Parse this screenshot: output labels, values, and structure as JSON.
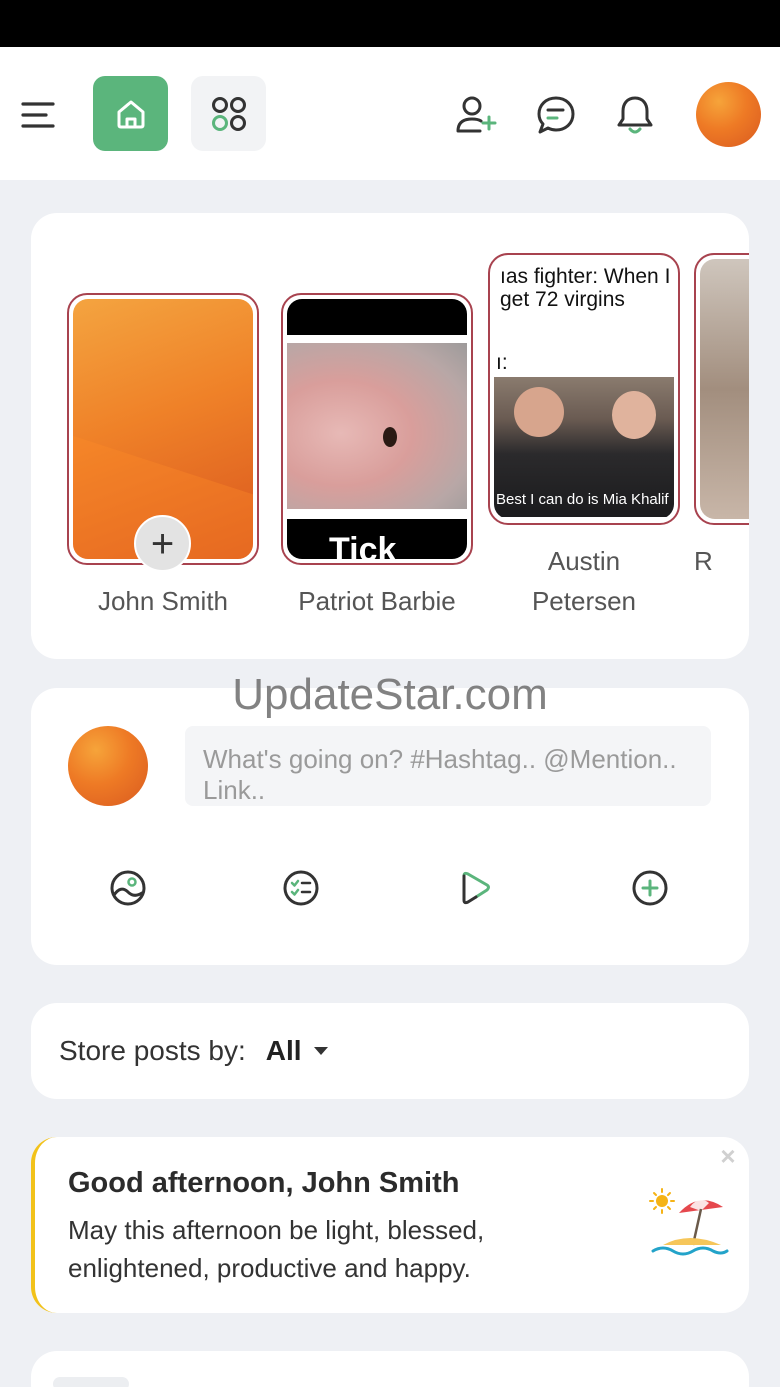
{
  "topbar": {
    "icons": [
      "menu-icon",
      "home-icon",
      "apps-icon",
      "add-user-icon",
      "message-icon",
      "bell-icon"
    ],
    "accent_color": "#5bb57c"
  },
  "stories": [
    {
      "name": "John Smith",
      "type": "add"
    },
    {
      "name": "Patriot Barbie",
      "caption": "Tick"
    },
    {
      "name": "Austin\nPetersen",
      "text_lines": [
        "ıas fighter: When I",
        " get 72 virgins"
      ],
      "colon": "ı:",
      "subtitle": "Best I can do is Mia Khalif"
    },
    {
      "name": "R"
    }
  ],
  "watermark": "UpdateStar.com",
  "composer": {
    "placeholder": "What's going on? #Hashtag.. @Mention.. Link.."
  },
  "filter": {
    "label": "Store posts by:",
    "value": "All"
  },
  "greeting": {
    "title": "Good afternoon, John Smith",
    "message": "May this afternoon be light, blessed, enlightened, productive and happy.",
    "close": "×",
    "accent_color": "#f2c21a"
  }
}
